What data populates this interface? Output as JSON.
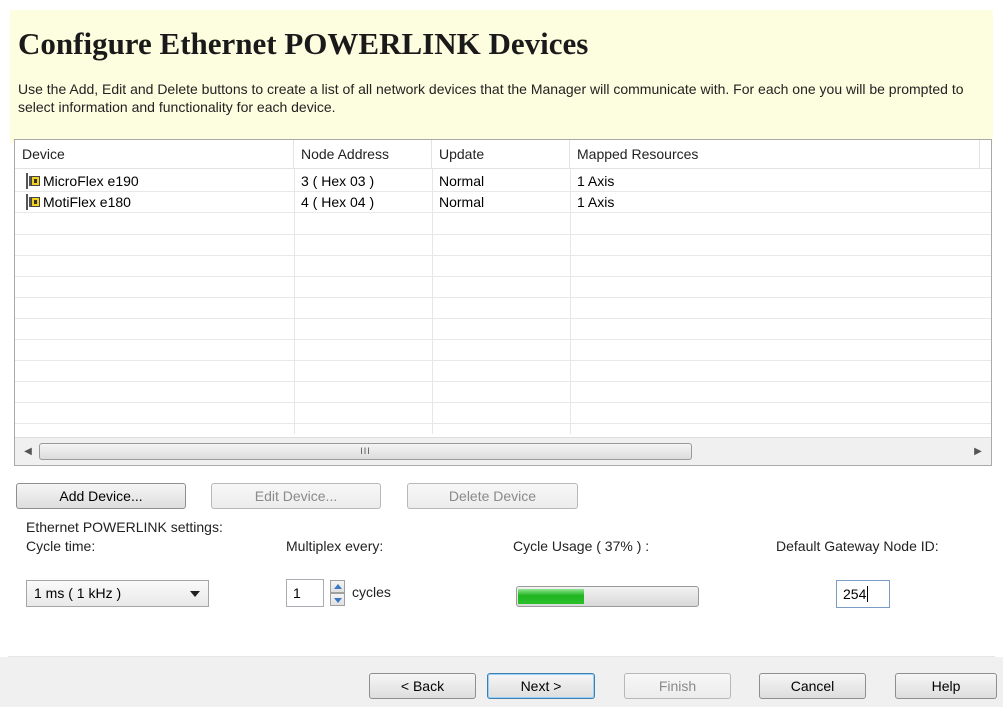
{
  "header": {
    "title": "Configure Ethernet POWERLINK Devices",
    "description": "Use the Add, Edit and Delete buttons to create a list of all network devices that the Manager will communicate with. For each one you will be prompted to select information and functionality for each device."
  },
  "device_list": {
    "columns": [
      "Device",
      "Node Address",
      "Update",
      "Mapped Resources"
    ],
    "rows": [
      {
        "device": "MicroFlex e190",
        "node_address": "3 ( Hex 03 )",
        "update": "Normal",
        "mapped": "1 Axis",
        "icon": "device-icon"
      },
      {
        "device": "MotiFlex e180",
        "node_address": "4 ( Hex 04 )",
        "update": "Normal",
        "mapped": "1 Axis",
        "icon": "device-icon"
      }
    ],
    "scrollbar_grip": "III"
  },
  "buttons": {
    "add": "Add Device...",
    "edit": "Edit Device...",
    "delete": "Delete Device"
  },
  "settings": {
    "group_label": "Ethernet POWERLINK settings:",
    "cycle_time_label": "Cycle time:",
    "cycle_time_value": "1 ms ( 1 kHz )",
    "multiplex_label": "Multiplex every:",
    "multiplex_value": "1",
    "multiplex_unit": "cycles",
    "cycle_usage_label": "Cycle Usage ( 37% ) :",
    "cycle_usage_percent": 37,
    "gateway_label": "Default Gateway Node ID:",
    "gateway_value": "254"
  },
  "footer": {
    "back": "< Back",
    "next": "Next >",
    "finish": "Finish",
    "cancel": "Cancel",
    "help": "Help"
  },
  "colors": {
    "header_bg": "#fdfde0",
    "progress_green": "#20b520",
    "device_icon_yellow": "#f2d01c"
  }
}
